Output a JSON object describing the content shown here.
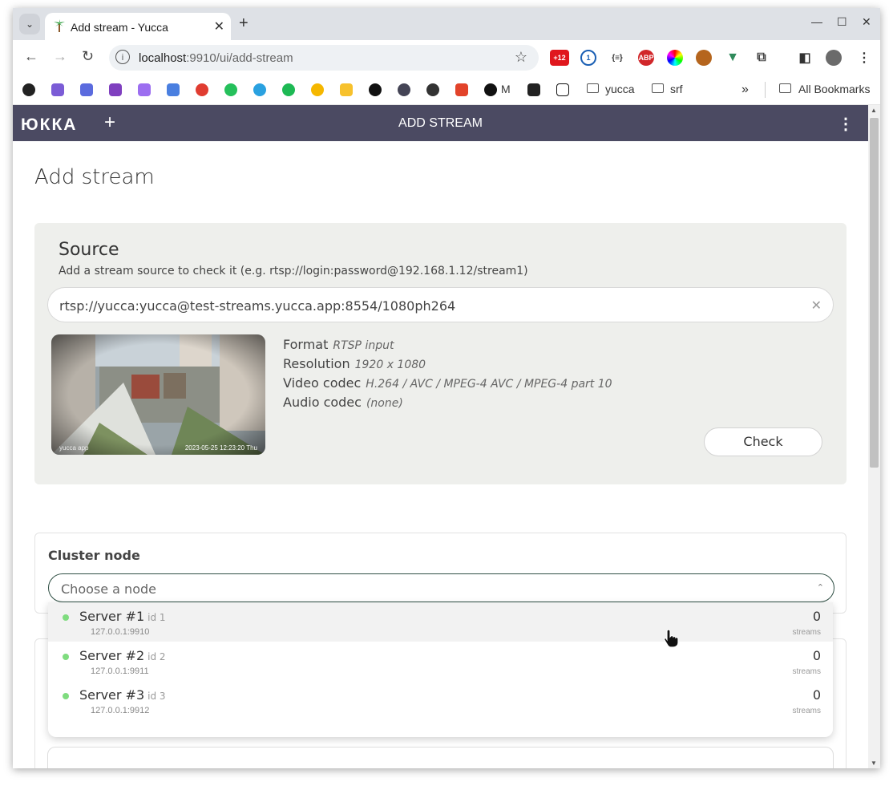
{
  "browser": {
    "tab_title": "Add stream - Yucca",
    "url_host": "localhost",
    "url_path": ":9910/ui/add-stream",
    "extensions_badge": "+12",
    "bookmarks": [
      {
        "label": "M"
      },
      {
        "label": "yucca"
      },
      {
        "label": "srf"
      },
      {
        "label": "All Bookmarks"
      }
    ]
  },
  "app": {
    "logo": "ЮККА",
    "header_title": "ADD STREAM",
    "accent_color": "#4b4a62"
  },
  "page": {
    "title": "Add stream"
  },
  "source": {
    "title": "Source",
    "description": "Add a stream source to check it (e.g. rtsp://login:password@192.168.1.12/stream1)",
    "url_value": "rtsp://yucca:yucca@test-streams.yucca.app:8554/1080ph264",
    "preview_overlay_left": "yucca app",
    "preview_timestamp": "2023-05-25 12:23:20 Thu",
    "properties": [
      {
        "key": "Format",
        "value": "RTSP input"
      },
      {
        "key": "Resolution",
        "value": "1920 x 1080"
      },
      {
        "key": "Video codec",
        "value": "H.264 / AVC / MPEG-4 AVC / MPEG-4 part 10"
      },
      {
        "key": "Audio codec",
        "value": "(none)"
      }
    ],
    "check_label": "Check"
  },
  "cluster": {
    "label": "Cluster node",
    "placeholder": "Choose a node",
    "nodes": [
      {
        "name": "Server #1",
        "id": "id 1",
        "address": "127.0.0.1:9910",
        "streams": "0",
        "streams_label": "streams",
        "status_color": "#7fdc7f"
      },
      {
        "name": "Server #2",
        "id": "id 2",
        "address": "127.0.0.1:9911",
        "streams": "0",
        "streams_label": "streams",
        "status_color": "#7fdc7f"
      },
      {
        "name": "Server #3",
        "id": "id 3",
        "address": "127.0.0.1:9912",
        "streams": "0",
        "streams_label": "streams",
        "status_color": "#7fdc7f"
      }
    ]
  }
}
